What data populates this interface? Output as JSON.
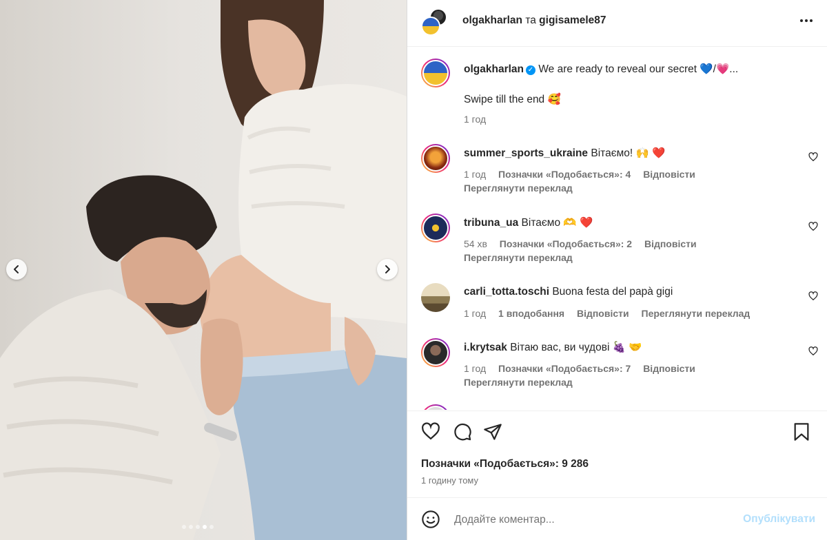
{
  "header": {
    "user1": "olgakharlan",
    "conjunction": "та",
    "user2": "gigisamele87"
  },
  "caption": {
    "username": "olgakharlan",
    "text": "We are ready to reveal our secret 💙/💗...",
    "line2": "Swipe till the end 🥰",
    "time": "1 год"
  },
  "comments": [
    {
      "username": "summer_sports_ukraine",
      "text": "Вітаємо! 🙌 ❤️",
      "time": "1 год",
      "likes": "Позначки «Подобається»: 4",
      "reply": "Відповісти",
      "translate": "Переглянути переклад"
    },
    {
      "username": "tribuna_ua",
      "text": "Вітаємо 🫶 ❤️",
      "time": "54 хв",
      "likes": "Позначки «Подобається»: 2",
      "reply": "Відповісти",
      "translate": "Переглянути переклад"
    },
    {
      "username": "carli_totta.toschi",
      "text": "Buona festa del papà gigi",
      "time": "1 год",
      "likes": "1 вподобання",
      "reply": "Відповісти",
      "translate": "Переглянути переклад"
    },
    {
      "username": "i.krytsak",
      "text": "Вітаю вас, ви чудові 🍇 🤝",
      "time": "1 год",
      "likes": "Позначки «Подобається»: 7",
      "reply": "Відповісти",
      "translate": "Переглянути переклад"
    }
  ],
  "footer": {
    "likes": "Позначки «Подобається»: 9 286",
    "time": "1 годину тому",
    "comment_placeholder": "Додайте коментар...",
    "publish": "Опублікувати"
  },
  "carousel": {
    "slide_count": 5,
    "active_slide_index": 3
  },
  "colors": {
    "accent": "#0095f6",
    "publish_disabled": "#b2dffc"
  }
}
